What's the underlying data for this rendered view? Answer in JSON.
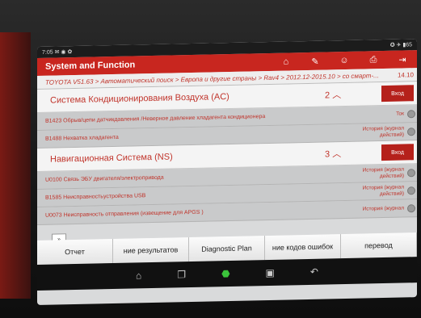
{
  "status": {
    "time": "7:05",
    "icons": "✉ ◉ ✿",
    "right": "✪ ✈ ▮65"
  },
  "header": {
    "title": "System and Function"
  },
  "breadcrumb": {
    "path": "TOYOTA V51.63 > Автоматический поиск > Европа и другие страны > Rav4 > 2012.12-2015.10 > со смарт-...",
    "right": "14.10"
  },
  "systems": [
    {
      "name": "Система Кондиционирования Воздуха (AC)",
      "count": "2",
      "enter": "Вход"
    },
    {
      "name": "Навигационная Система (NS)",
      "count": "3",
      "enter": "Вход"
    }
  ],
  "faults_ac": [
    {
      "code": "B1423 Обрыв/цепи датчикдавления /Неверное давление хладагента кондиционера",
      "action": "Ток"
    },
    {
      "code": "B1488 Нехватка хладагента",
      "action": "История (журнал действий)"
    }
  ],
  "faults_ns": [
    {
      "code": "U0100 Связь ЭБУ двигателя/электропривода",
      "action": "История (журнал действий)"
    },
    {
      "code": "B1585 Неисправностьустройства USB",
      "action": "История (журнал действий)"
    },
    {
      "code": "U0073 Неисправность отправления (извещение для APGS )",
      "action": "История (журнал"
    }
  ],
  "bottom": {
    "report": "Отчет",
    "results": "ние результатов",
    "diag_plan": "Diagnostic Plan",
    "clear": "ние кодов ошибок",
    "translate": "перевод"
  },
  "colors": {
    "accent": "#c8261f"
  }
}
